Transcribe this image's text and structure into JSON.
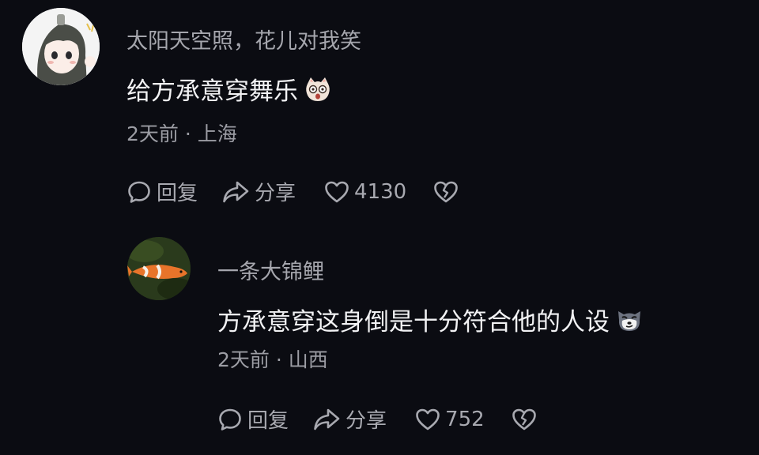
{
  "comment": {
    "username": "太阳天空照，花儿对我笑",
    "text": "给方承意穿舞乐",
    "emoji": "surprised-cat-emoji",
    "meta": "2天前 · 上海",
    "reply_label": "回复",
    "share_label": "分享",
    "like_count": "4130"
  },
  "reply": {
    "username": "一条大锦鲤",
    "text": "方承意穿这身倒是十分符合他的人设",
    "emoji": "smug-wolf-emoji",
    "meta": "2天前 · 山西",
    "reply_label": "回复",
    "share_label": "分享",
    "like_count": "752"
  },
  "colors": {
    "background": "#0b0c12",
    "username": "#a5a6ad",
    "text": "#f2f2f4",
    "meta": "#9c9da4",
    "koi_orange": "#e8742a"
  }
}
